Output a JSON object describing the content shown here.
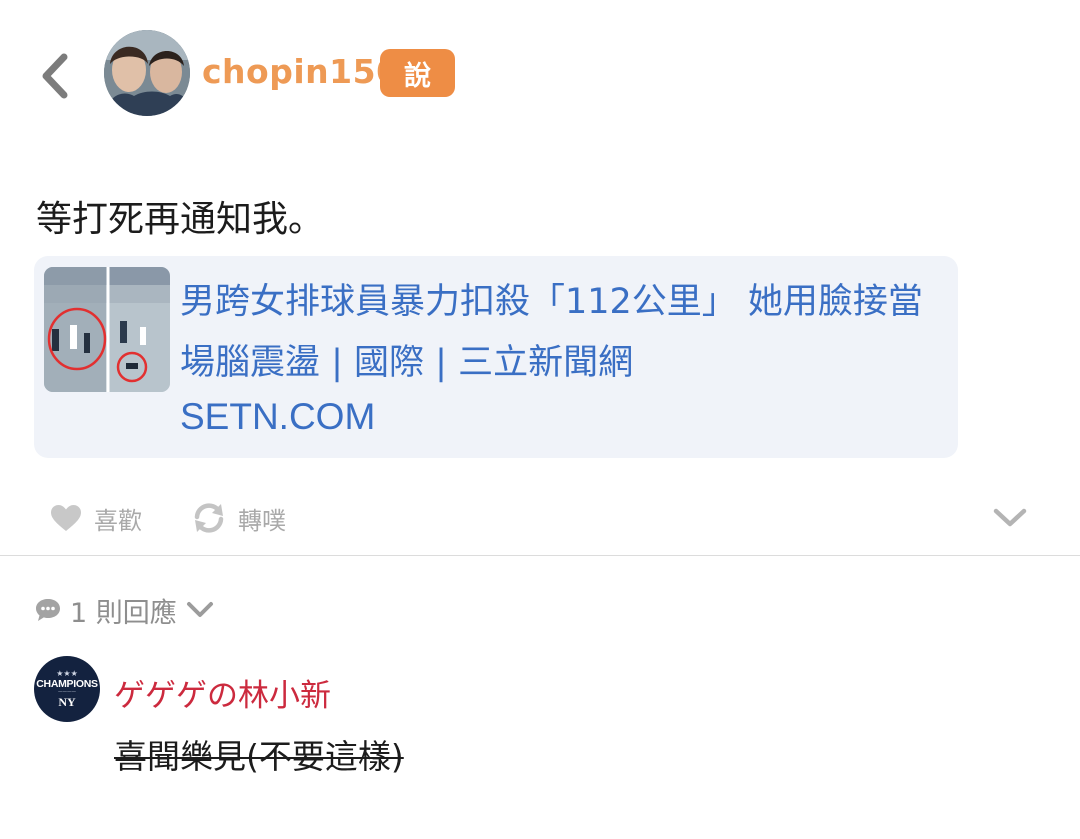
{
  "header": {
    "back_icon": "chevron-left-icon",
    "username": "chopin150",
    "post_type_badge": "說",
    "username_color": "#ee9a55",
    "badge_color": "#ee8d45"
  },
  "post": {
    "text": "等打死再通知我。",
    "link_card": {
      "title": "男跨女排球員暴力扣殺「112公里」 她用臉接當場腦震盪 | 國際 | 三立新聞網",
      "domain": "SETN.COM",
      "link_color": "#3a6fc4"
    },
    "actions": {
      "like_label": "喜歡",
      "like_icon": "heart-icon",
      "share_label": "轉噗",
      "share_icon": "replurk-icon",
      "expand_icon": "chevron-down-icon"
    }
  },
  "comments": {
    "count_label": "1 則回應",
    "icon": "speech-bubble-icon",
    "items": [
      {
        "avatar_text": "CHAMPIONS",
        "avatar_logo": "NY",
        "username": "ゲゲゲの林小新",
        "username_color": "#cc2a3e",
        "text": "喜聞樂見(不要這樣)"
      }
    ]
  }
}
